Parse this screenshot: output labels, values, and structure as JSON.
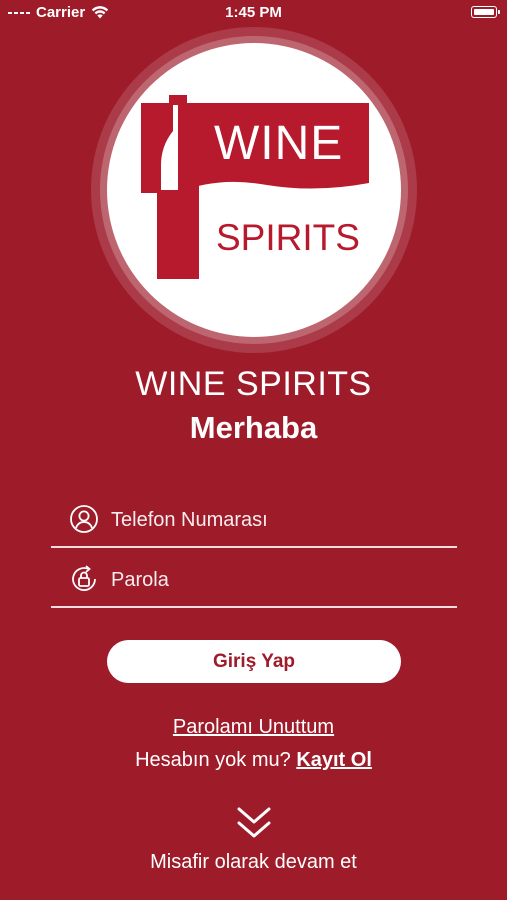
{
  "status_bar": {
    "carrier": "Carrier",
    "time": "1:45 PM",
    "icons": [
      "signal-icon",
      "wifi-icon",
      "battery-icon"
    ]
  },
  "logo": {
    "word_top": "WINE",
    "word_bottom": "SPIRITS",
    "icon": "wine-bottle-icon"
  },
  "header": {
    "title": "WINE SPIRITS",
    "greeting": "Merhaba"
  },
  "form": {
    "phone": {
      "placeholder": "Telefon Numarası",
      "value": "",
      "icon": "user-icon"
    },
    "password": {
      "placeholder": "Parola",
      "value": "",
      "icon": "lock-reset-icon"
    },
    "login_label": "Giriş Yap"
  },
  "links": {
    "forgot_password": "Parolamı Unuttum",
    "no_account": "Hesabın yok mu?",
    "register": "Kayıt Ol",
    "guest": "Misafir olarak devam et",
    "guest_icon": "double-chevron-down-icon"
  },
  "colors": {
    "background": "#9e1b2a",
    "logo_red": "#b7192d",
    "text": "#ffffff"
  }
}
